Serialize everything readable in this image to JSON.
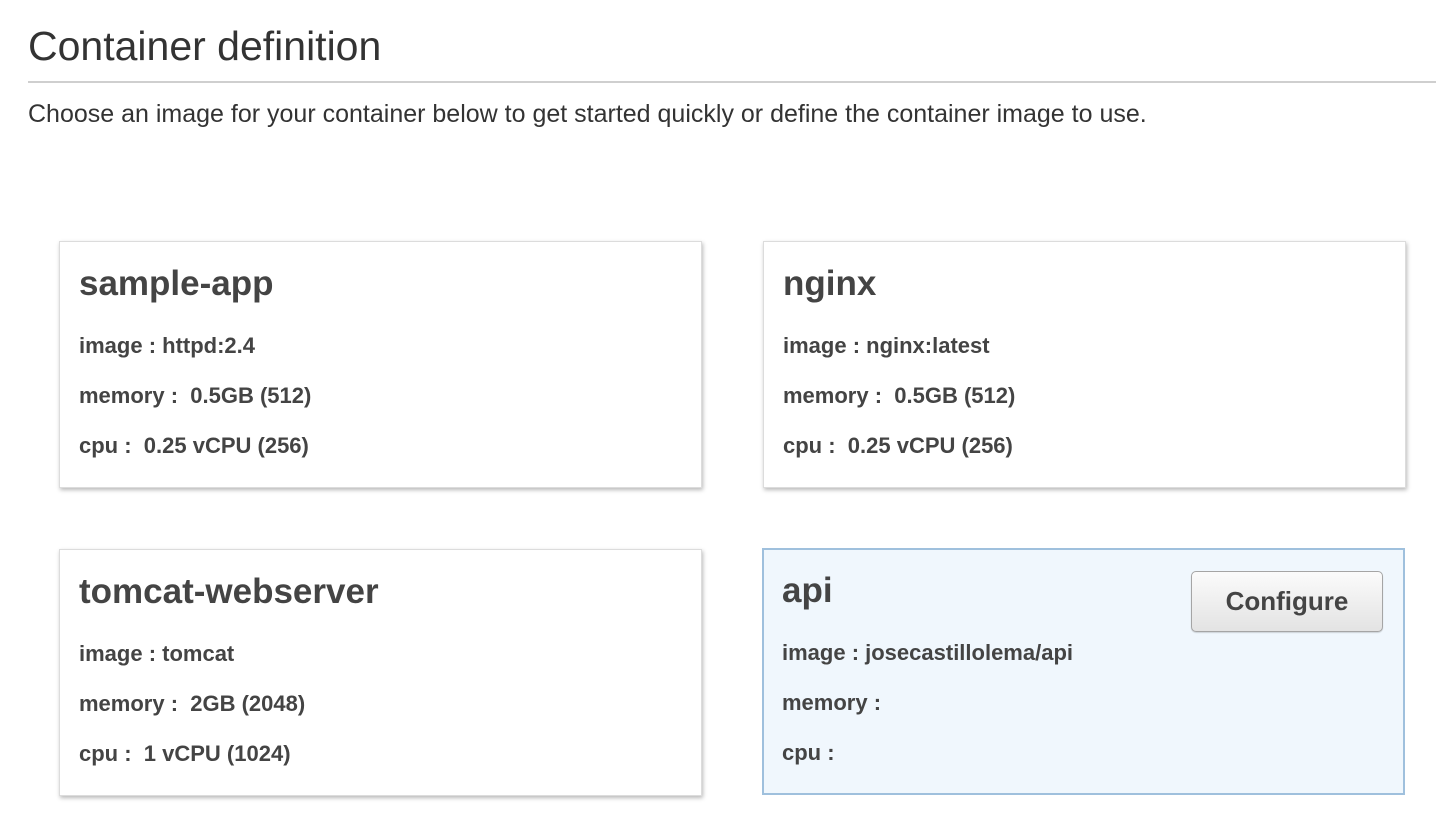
{
  "header": {
    "title": "Container definition",
    "description": "Choose an image for your container below to get started quickly or define the container image to use."
  },
  "cards": [
    {
      "name": "sample-app",
      "image": "image : httpd:2.4",
      "memory": "memory :  0.5GB (512)",
      "cpu": "cpu :  0.25 vCPU (256)"
    },
    {
      "name": "nginx",
      "image": "image : nginx:latest",
      "memory": "memory :  0.5GB (512)",
      "cpu": "cpu :  0.25 vCPU (256)"
    },
    {
      "name": "tomcat-webserver",
      "image": "image : tomcat",
      "memory": "memory :  2GB (2048)",
      "cpu": "cpu :  1 vCPU (1024)"
    },
    {
      "name": "api",
      "image": "image : josecastillolema/api",
      "memory": "memory :",
      "cpu": "cpu :",
      "selected": true,
      "button_label": "Configure"
    }
  ],
  "colors": {
    "selected_card_bg": "#f0f7fd",
    "selected_card_border": "#9fc0dd",
    "text": "#444444"
  }
}
